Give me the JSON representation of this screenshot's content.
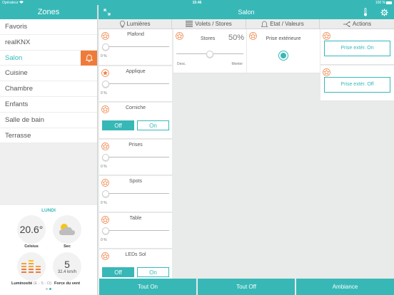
{
  "statusbar": {
    "carrier": "Opérateur",
    "time": "15:46",
    "battery": "100 %"
  },
  "left": {
    "title": "Zones",
    "zones": [
      "Favoris",
      "realKNX",
      "Salon",
      "Cuisine",
      "Chambre",
      "Enfants",
      "Salle de bain",
      "Terrasse"
    ],
    "active_zone": "Salon"
  },
  "weather": {
    "day": "LUNDI",
    "temperature": "20.6°",
    "temperature_label": "Celsius",
    "sky_label": "Sec",
    "luminosity_label": "Luminosité",
    "luminosity_dirs": "(E - S - O)",
    "wind_value": "5",
    "wind_speed": "32.4 km/h",
    "wind_label": "Force du vent"
  },
  "main": {
    "title": "Salon",
    "columns": [
      "Lumières",
      "Volets / Stores",
      "Etat / Valeurs",
      "Actions"
    ],
    "lights": [
      {
        "name": "Plafond",
        "kind": "slider",
        "pct": "0 %",
        "level": 0,
        "favorite": false
      },
      {
        "name": "Applique",
        "kind": "slider",
        "pct": "0 %",
        "level": 0,
        "favorite": true
      },
      {
        "name": "Corniche",
        "kind": "toggle",
        "off": "Off",
        "on": "On",
        "favorite": false
      },
      {
        "name": "Prises",
        "kind": "slider",
        "pct": "0 %",
        "level": 0,
        "favorite": false
      },
      {
        "name": "Spots",
        "kind": "slider",
        "pct": "0 %",
        "level": 0,
        "favorite": false
      },
      {
        "name": "Table",
        "kind": "slider",
        "pct": "0 %",
        "level": 0,
        "favorite": false
      },
      {
        "name": "LEDs Sol",
        "kind": "toggle",
        "off": "Off",
        "on": "On",
        "favorite": false
      }
    ],
    "stores": {
      "name": "Stores",
      "value": "50%",
      "level": 0.5,
      "desc": "Desc.",
      "monter": "Monter"
    },
    "etat": {
      "name": "Prise extérieure"
    },
    "actions": [
      "Prise extér. On",
      "Prise extér. Off"
    ],
    "bottom": [
      "Tout On",
      "Tout Off",
      "Ambiance"
    ]
  },
  "colors": {
    "accent": "#37b8b7",
    "alert": "#ef7b3a",
    "star": "#ef7b3a"
  },
  "icons": [
    "bell-icon",
    "star-icon",
    "expand-icon",
    "thermometer-icon",
    "gear-icon",
    "bulb-icon",
    "shutter-icon",
    "bell-outline-icon",
    "share-icon",
    "sun-cloud-icon",
    "bars-icon",
    "wifi-icon"
  ]
}
